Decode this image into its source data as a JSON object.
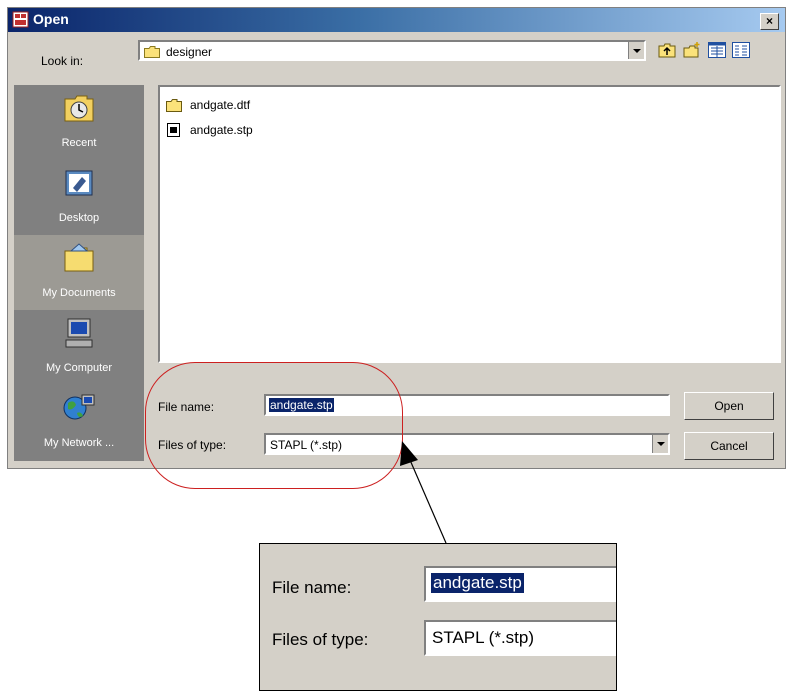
{
  "window": {
    "title": "Open",
    "close_label": "×"
  },
  "lookin": {
    "label": "Look in:",
    "value": "designer",
    "toolbar_icons": [
      "up-one-level-icon",
      "create-new-folder-icon",
      "list-view-icon",
      "details-view-icon"
    ]
  },
  "places": {
    "items": [
      {
        "label": "Recent",
        "icon": "recent-icon"
      },
      {
        "label": "Desktop",
        "icon": "desktop-icon"
      },
      {
        "label": "My Documents",
        "icon": "my-documents-icon"
      },
      {
        "label": "My Computer",
        "icon": "my-computer-icon"
      },
      {
        "label": "My Network ...",
        "icon": "my-network-icon"
      }
    ]
  },
  "files": [
    {
      "name": "andgate.dtf",
      "icon": "folder-icon"
    },
    {
      "name": "andgate.stp",
      "icon": "stp-file-icon"
    }
  ],
  "form": {
    "filename_label": "File name:",
    "filename_value": "andgate.stp",
    "filetype_label": "Files of type:",
    "filetype_value": "STAPL (*.stp)",
    "open_button": "Open",
    "cancel_button": "Cancel"
  },
  "zoom": {
    "filename_label": "File name:",
    "filename_value": "andgate.stp",
    "filetype_label": "Files of type:",
    "filetype_value": "STAPL (*.stp)"
  },
  "colors": {
    "dialog_bg": "#d4d0c8",
    "title_bar": "#0a246a",
    "selection": "#0a246a",
    "highlight_ellipse": "#cc2020",
    "places_bg": "#808080"
  }
}
